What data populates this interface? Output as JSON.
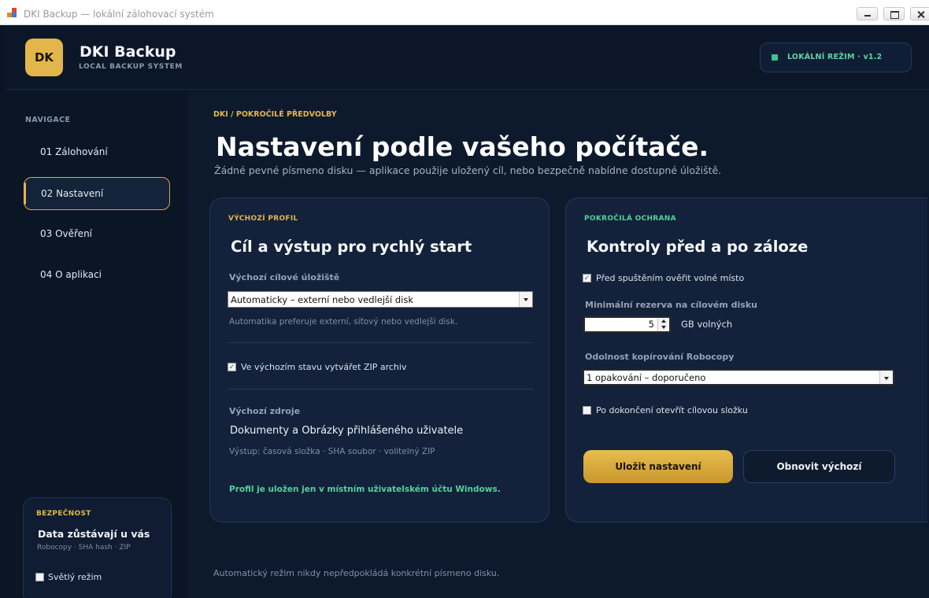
{
  "window": {
    "title": "DKI Backup — lokální zálohovací systém"
  },
  "header": {
    "logo": "DK",
    "brand": "DKI Backup",
    "brand_sub": "LOCAL BACKUP SYSTEM",
    "mode": "LOKÁLNÍ REŽIM · v1.2"
  },
  "sidebar": {
    "heading": "NAVIGACE",
    "items": [
      {
        "label": "01  Zálohování",
        "active": false
      },
      {
        "label": "02  Nastavení",
        "active": true
      },
      {
        "label": "03  Ověření",
        "active": false
      },
      {
        "label": "04  O aplikaci",
        "active": false
      }
    ],
    "security": {
      "kicker": "BEZPEČNOST",
      "title": "Data zůstávají u vás",
      "subtitle": "Robocopy · SHA hash · ZIP",
      "light_mode_label": "Světlý režim",
      "light_mode_checked": false
    }
  },
  "main": {
    "breadcrumb": "DKI / POKROČILÉ PŘEDVOLBY",
    "title": "Nastavení podle vašeho počítače.",
    "subtitle": "Žádné pevné písmeno disku — aplikace použije uložený cíl, nebo bezpečně nabídne dostupné úložiště.",
    "footer": "Automatický režim nikdy nepředpokládá konkrétní písmeno disku."
  },
  "profile_card": {
    "kicker": "VÝCHOZÍ PROFIL",
    "title": "Cíl a výstup pro rychlý start",
    "target_label": "Výchozí cílové úložiště",
    "target_value": "Automaticky – externí nebo vedlejší disk",
    "target_hint": "Automatika preferuje externí, síťový nebo vedlejší disk.",
    "zip_label": "Ve výchozím stavu vytvářet ZIP archiv",
    "zip_checked": true,
    "sources_label": "Výchozí zdroje",
    "sources_value": "Dokumenty a Obrázky přihlášeného uživatele",
    "sources_hint": "Výstup: časová složka · SHA soubor · volitelný ZIP",
    "saved_note": "Profil je uložen jen v místním uživatelském účtu Windows."
  },
  "protection_card": {
    "kicker": "POKROČILÁ OCHRANA",
    "title": "Kontroly před a po záloze",
    "check_space_label": "Před spuštěním ověřit volné místo",
    "check_space_checked": true,
    "reserve_label": "Minimální rezerva na cílovém disku",
    "reserve_value": "5",
    "reserve_unit": "GB volných",
    "robocopy_label": "Odolnost kopírování Robocopy",
    "robocopy_value": "1 opakování – doporučeno",
    "open_folder_label": "Po dokončení otevřít cílovou složku",
    "open_folder_checked": false,
    "save_button": "Uložit nastavení",
    "reset_button": "Obnovit výchozí"
  },
  "colors": {
    "accent_gold": "#e2b64a",
    "accent_green": "#55cf9c",
    "background": "#0b1729",
    "card": "#13223a"
  }
}
